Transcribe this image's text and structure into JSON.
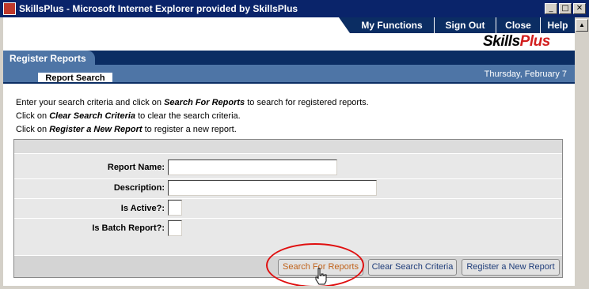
{
  "window": {
    "title": "SkillsPlus - Microsoft Internet Explorer provided by SkillsPlus",
    "controls": {
      "minimize": "_",
      "maximize": "□",
      "close": "✕"
    },
    "scroll_up": "▲"
  },
  "topnav": {
    "items": [
      {
        "label": "My Functions"
      },
      {
        "label": "Sign Out"
      },
      {
        "label": "Close"
      },
      {
        "label": "Help"
      }
    ]
  },
  "logo": {
    "part1": "Skills",
    "part2": "Plus"
  },
  "header": {
    "section_tab": "Register Reports",
    "subtab": "Report Search",
    "date": "Thursday, February 7"
  },
  "instructions": {
    "line1": {
      "before": "Enter your search criteria and click on ",
      "bold": "Search For Reports",
      "after": " to search for registered reports."
    },
    "line2": {
      "before": "Click on ",
      "bold": "Clear Search Criteria",
      "after": " to clear the search criteria."
    },
    "line3": {
      "before": "Click on ",
      "bold": "Register a New Report",
      "after": " to register a new report."
    }
  },
  "form": {
    "report_name": {
      "label": "Report Name:",
      "value": ""
    },
    "description": {
      "label": "Description:",
      "value": ""
    },
    "is_active": {
      "label": "Is Active?:",
      "value": ""
    },
    "is_batch": {
      "label": "Is Batch Report?:",
      "value": ""
    }
  },
  "buttons": {
    "search": "Search For Reports",
    "clear": "Clear Search Criteria",
    "register": "Register a New Report"
  },
  "colors": {
    "titlebar": "#0a246a",
    "nav_dark": "#0b2d63",
    "band_mid": "#4e75a6",
    "highlight": "#e01010",
    "logo_accent": "#d21e1e"
  }
}
